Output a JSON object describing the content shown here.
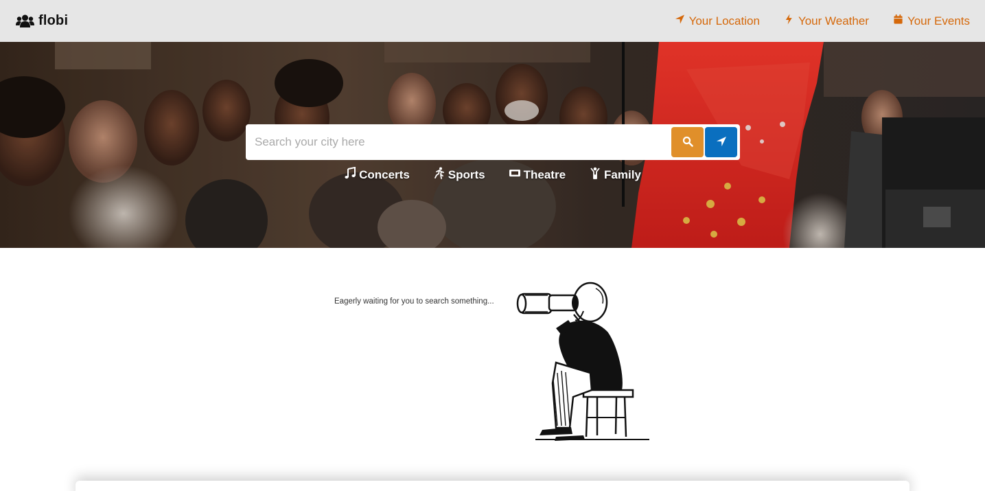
{
  "brand": {
    "name": "flobi",
    "icon": "users-icon"
  },
  "nav": {
    "links": [
      {
        "label": "Your Location",
        "icon": "location-arrow-icon"
      },
      {
        "label": "Your Weather",
        "icon": "bolt-icon"
      },
      {
        "label": "Your Events",
        "icon": "calendar-icon"
      }
    ],
    "accent_color": "#d5680a"
  },
  "search": {
    "placeholder": "Search your city here",
    "value": "",
    "search_button_icon": "search-icon",
    "locate_button_icon": "location-arrow-icon",
    "search_button_color": "#e08f2a",
    "locate_button_color": "#0a6fbf"
  },
  "categories": [
    {
      "label": "Concerts",
      "icon": "music-icon"
    },
    {
      "label": "Sports",
      "icon": "running-icon"
    },
    {
      "label": "Theatre",
      "icon": "ticket-icon"
    },
    {
      "label": "Family",
      "icon": "child-icon"
    }
  ],
  "empty_state": {
    "message": "Eagerly waiting for you to search something...",
    "illustration": "man-with-binoculars-illustration"
  }
}
